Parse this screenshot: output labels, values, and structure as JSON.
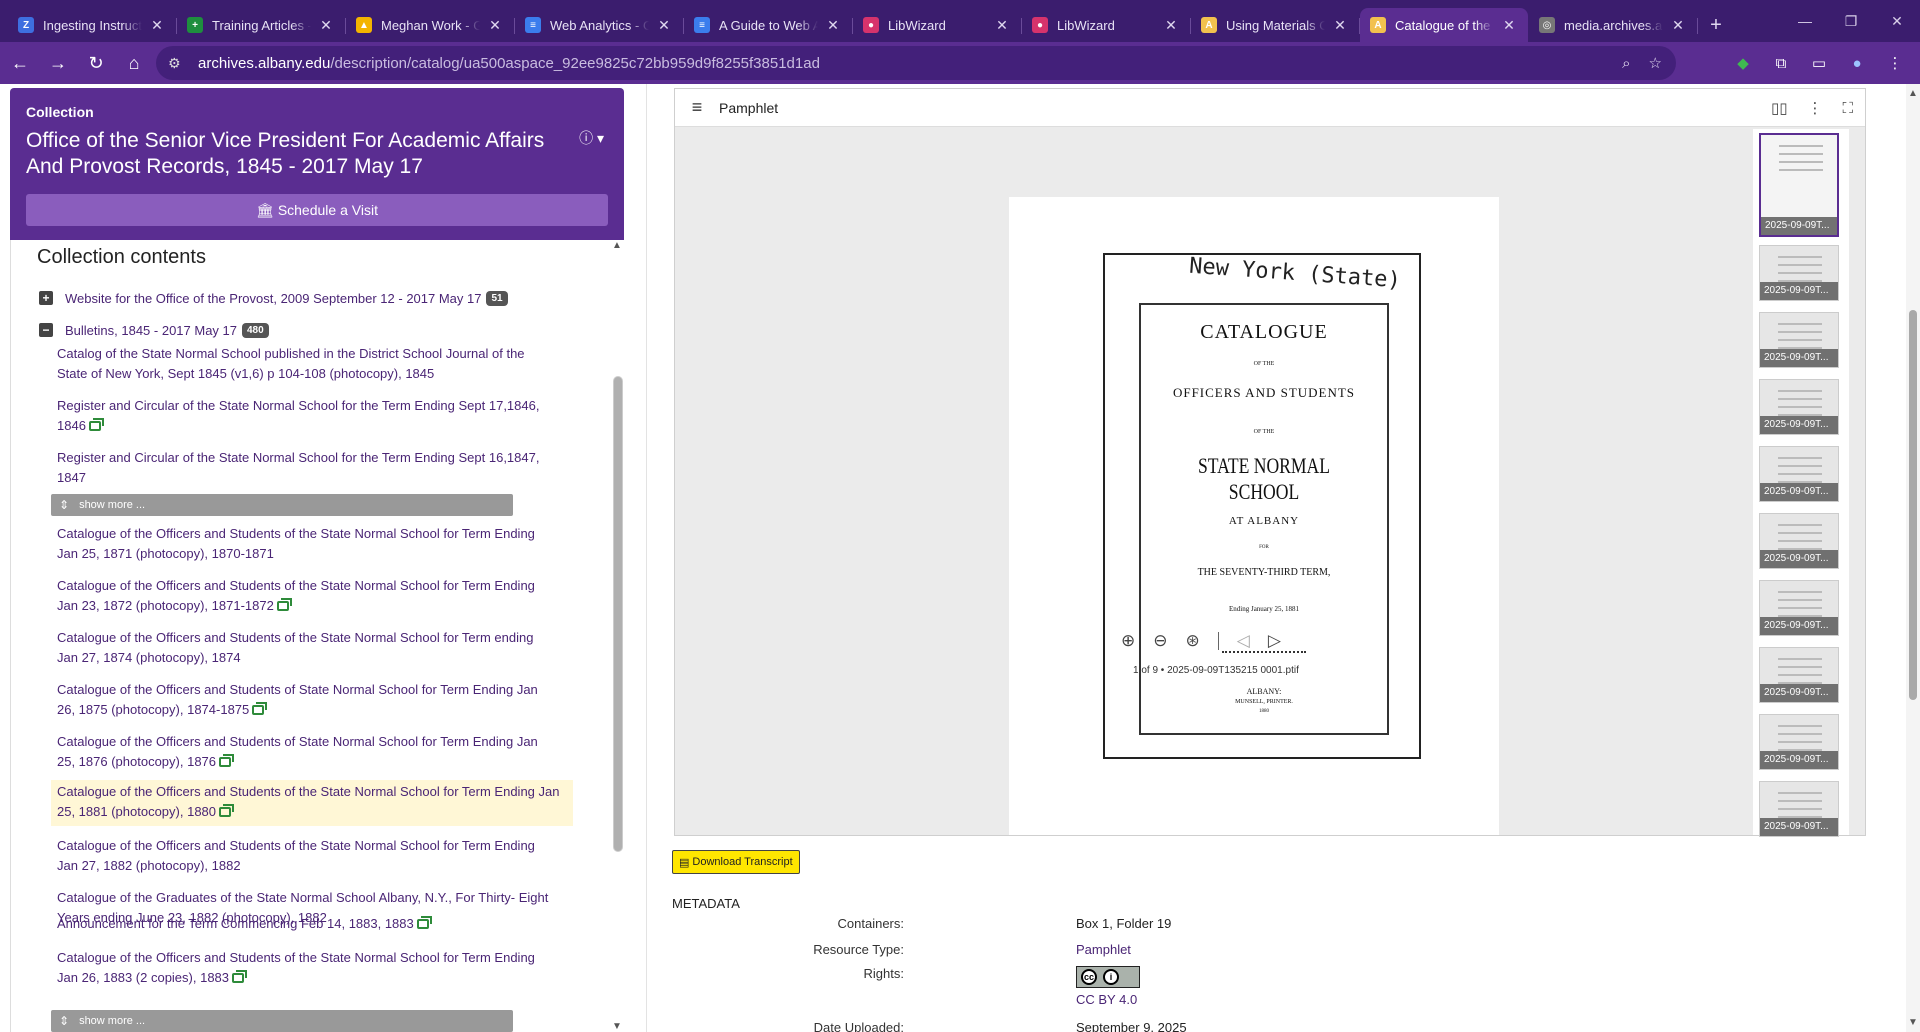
{
  "browser": {
    "tabs": [
      {
        "title": "Ingesting Instructi",
        "icon": "zotero-icon",
        "color": "#3e6fe0",
        "glyph": "Z"
      },
      {
        "title": "Training Articles -",
        "icon": "sheets-icon",
        "color": "#1e8e3e",
        "glyph": "+"
      },
      {
        "title": "Meghan Work - Go",
        "icon": "drive-icon",
        "color": "#f4b400",
        "glyph": "▲"
      },
      {
        "title": "Web Analytics - Go",
        "icon": "docs-icon",
        "color": "#3b7ded",
        "glyph": "≡"
      },
      {
        "title": "A Guide to Web A",
        "icon": "docs-icon",
        "color": "#3b7ded",
        "glyph": "≡"
      },
      {
        "title": "LibWizard",
        "icon": "libwizard-icon",
        "color": "#d6336c",
        "glyph": "●"
      },
      {
        "title": "LibWizard",
        "icon": "libwizard-icon",
        "color": "#d6336c",
        "glyph": "●"
      },
      {
        "title": "Using Materials Or",
        "icon": "archives-icon",
        "color": "#f2c14e",
        "glyph": "A"
      },
      {
        "title": "Catalogue of the O",
        "icon": "archives-icon",
        "color": "#f2c14e",
        "glyph": "A",
        "active": true
      },
      {
        "title": "media.archives.alb",
        "icon": "globe-icon",
        "color": "#777777",
        "glyph": "◎"
      }
    ],
    "url_host": "archives.albany.edu",
    "url_path": "/description/catalog/ua500aspace_92ee9825c72bb959d9f8255f3851d1ad"
  },
  "collection": {
    "kicker": "Collection",
    "title": "Office of the Senior Vice President For Academic Affairs And Provost Records, 1845 - 2017 May 17",
    "schedule_label": "Schedule a Visit",
    "contents_heading": "Collection contents",
    "series": [
      {
        "toggle": "+",
        "label": "Website for the Office of the Provost, 2009 September 12 - 2017 May 17",
        "count": "51"
      },
      {
        "toggle": "−",
        "label": "Bulletins, 1845 - 2017 May 17",
        "count": "480"
      }
    ],
    "items": [
      {
        "text": "Catalog of the State Normal School published in the District School Journal of the State of New York, Sept 1845 (v1,6) p 104-108 (photocopy), 1845",
        "digital": false
      },
      {
        "text": "Register and Circular of the State Normal School for the Term Ending Sept 17,1846, 1846",
        "digital": true
      },
      {
        "text": "Register and Circular of the State Normal School for the Term Ending Sept 16,1847, 1847",
        "digital": false
      },
      {
        "text": "Catalogue of the Officers and Students of the State Normal School for Term Ending Jan 25, 1871 (photocopy), 1870-1871",
        "digital": false
      },
      {
        "text": "Catalogue of the Officers and Students of the State Normal School for Term Ending Jan 23, 1872 (photocopy), 1871-1872",
        "digital": true
      },
      {
        "text": "Catalogue of the Officers and Students of the State Normal School for Term ending Jan 27, 1874 (photocopy), 1874",
        "digital": false
      },
      {
        "text": "Catalogue of the Officers and Students of State Normal School for Term Ending Jan 26, 1875 (photocopy), 1874-1875",
        "digital": true
      },
      {
        "text": "Catalogue of the Officers and Students of State Normal School for Term Ending Jan 25, 1876 (photocopy), 1876",
        "digital": true
      },
      {
        "text": "Catalogue of the Officers and Students of the State Normal School for Term Ending Jan 25, 1881 (photocopy), 1880",
        "digital": true,
        "highlight": true
      },
      {
        "text": "Catalogue of the Officers and Students of the State Normal School for Term Ending Jan 27, 1882 (photocopy), 1882",
        "digital": false
      },
      {
        "text": "Catalogue of the Graduates of the State Normal School Albany, N.Y., For Thirty- Eight Years ending June 23, 1882 (photocopy), 1882",
        "digital": false
      },
      {
        "text": "Announcement for the Term Commencing Feb 14, 1883, 1883",
        "digital": true
      },
      {
        "text": "Catalogue of the Officers and Students of the State Normal School for Term Ending Jan 26, 1883 (2 copies), 1883",
        "digital": true
      }
    ],
    "show_more": "show more ..."
  },
  "viewer": {
    "label": "Pamphlet",
    "page_caption": "1 of 9 • 2025-09-09T135215 0001.ptif",
    "thumb_label": "2025-09-09T...",
    "thumb_count": 10,
    "scan": {
      "handwriting": "New York (State)",
      "line1": "CATALOGUE",
      "line2": "OF THE",
      "line3": "OFFICERS AND STUDENTS",
      "line4": "OF THE",
      "line5": "STATE NORMAL SCHOOL",
      "line6": "AT ALBANY",
      "line7": "FOR",
      "line8": "THE SEVENTY-THIRD TERM,",
      "line9": "Ending January 25, 1881",
      "line10": "ALBANY:",
      "line11": "MUNSELL, PRINTER.",
      "line12": "1880"
    }
  },
  "download_label": "Download Transcript",
  "metadata": {
    "heading": "METADATA",
    "rows": [
      {
        "key": "Containers:",
        "value": "Box 1, Folder 19"
      },
      {
        "key": "Resource Type:",
        "value": "Pamphlet",
        "link": true
      },
      {
        "key": "Rights:",
        "value": "CC BY 4.0",
        "link": true
      },
      {
        "key": "Date Uploaded:",
        "value": "September 9, 2025"
      }
    ]
  }
}
